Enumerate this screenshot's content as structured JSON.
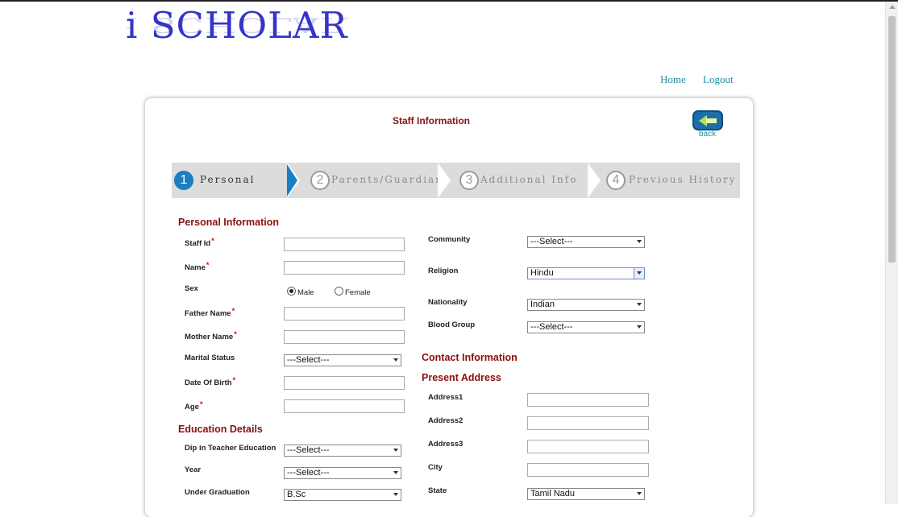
{
  "header": {
    "logo_text": "i SCHOLAR",
    "nav": {
      "home": "Home",
      "logout": "Logout"
    }
  },
  "page": {
    "title": "Staff Information",
    "back_label": "back"
  },
  "wizard": {
    "steps": [
      {
        "num": "1",
        "label": "Personal",
        "active": true
      },
      {
        "num": "2",
        "label": "Parents/Guardian",
        "active": false
      },
      {
        "num": "3",
        "label": "Additional Info",
        "active": false
      },
      {
        "num": "4",
        "label": "Previous History",
        "active": false
      }
    ]
  },
  "personal": {
    "title": "Personal Information",
    "staff_id": {
      "label": "Staff Id",
      "required": "*",
      "value": ""
    },
    "name": {
      "label": "Name",
      "required": "*",
      "value": ""
    },
    "sex": {
      "label": "Sex",
      "options": [
        "Male",
        "Female"
      ],
      "selected": "Male"
    },
    "father_name": {
      "label": "Father Name",
      "required": "*",
      "value": ""
    },
    "mother_name": {
      "label": "Mother Name",
      "required": "*",
      "value": ""
    },
    "marital_status": {
      "label": "Marital Status",
      "value": "---Select---"
    },
    "dob": {
      "label": "Date Of Birth",
      "required": "*",
      "value": ""
    },
    "age": {
      "label": "Age",
      "required": "*",
      "value": ""
    }
  },
  "education": {
    "title": "Education Details",
    "dip": {
      "label": "Dip in Teacher Education",
      "value": "---Select---"
    },
    "year": {
      "label": "Year",
      "value": "---Select---"
    },
    "ug": {
      "label": "Under Graduation",
      "value": "B.Sc"
    }
  },
  "right": {
    "community": {
      "label": "Community",
      "value": "---Select---"
    },
    "religion": {
      "label": "Religion",
      "value": "Hindu"
    },
    "nationality": {
      "label": "Nationality",
      "value": "Indian"
    },
    "blood_group": {
      "label": "Blood Group",
      "value": "---Select---"
    }
  },
  "contact": {
    "title": "Contact Information",
    "present_title": "Present Address",
    "address1": {
      "label": "Address1",
      "value": ""
    },
    "address2": {
      "label": "Address2",
      "value": ""
    },
    "address3": {
      "label": "Address3",
      "value": ""
    },
    "city": {
      "label": "City",
      "value": ""
    },
    "state": {
      "label": "State",
      "value": "Tamil Nadu"
    }
  },
  "colors": {
    "accent_blue": "#1a7fc1",
    "heading_red": "#8b0f0f",
    "link_teal": "#1c8fa3",
    "logo_blue": "#3434c6"
  }
}
